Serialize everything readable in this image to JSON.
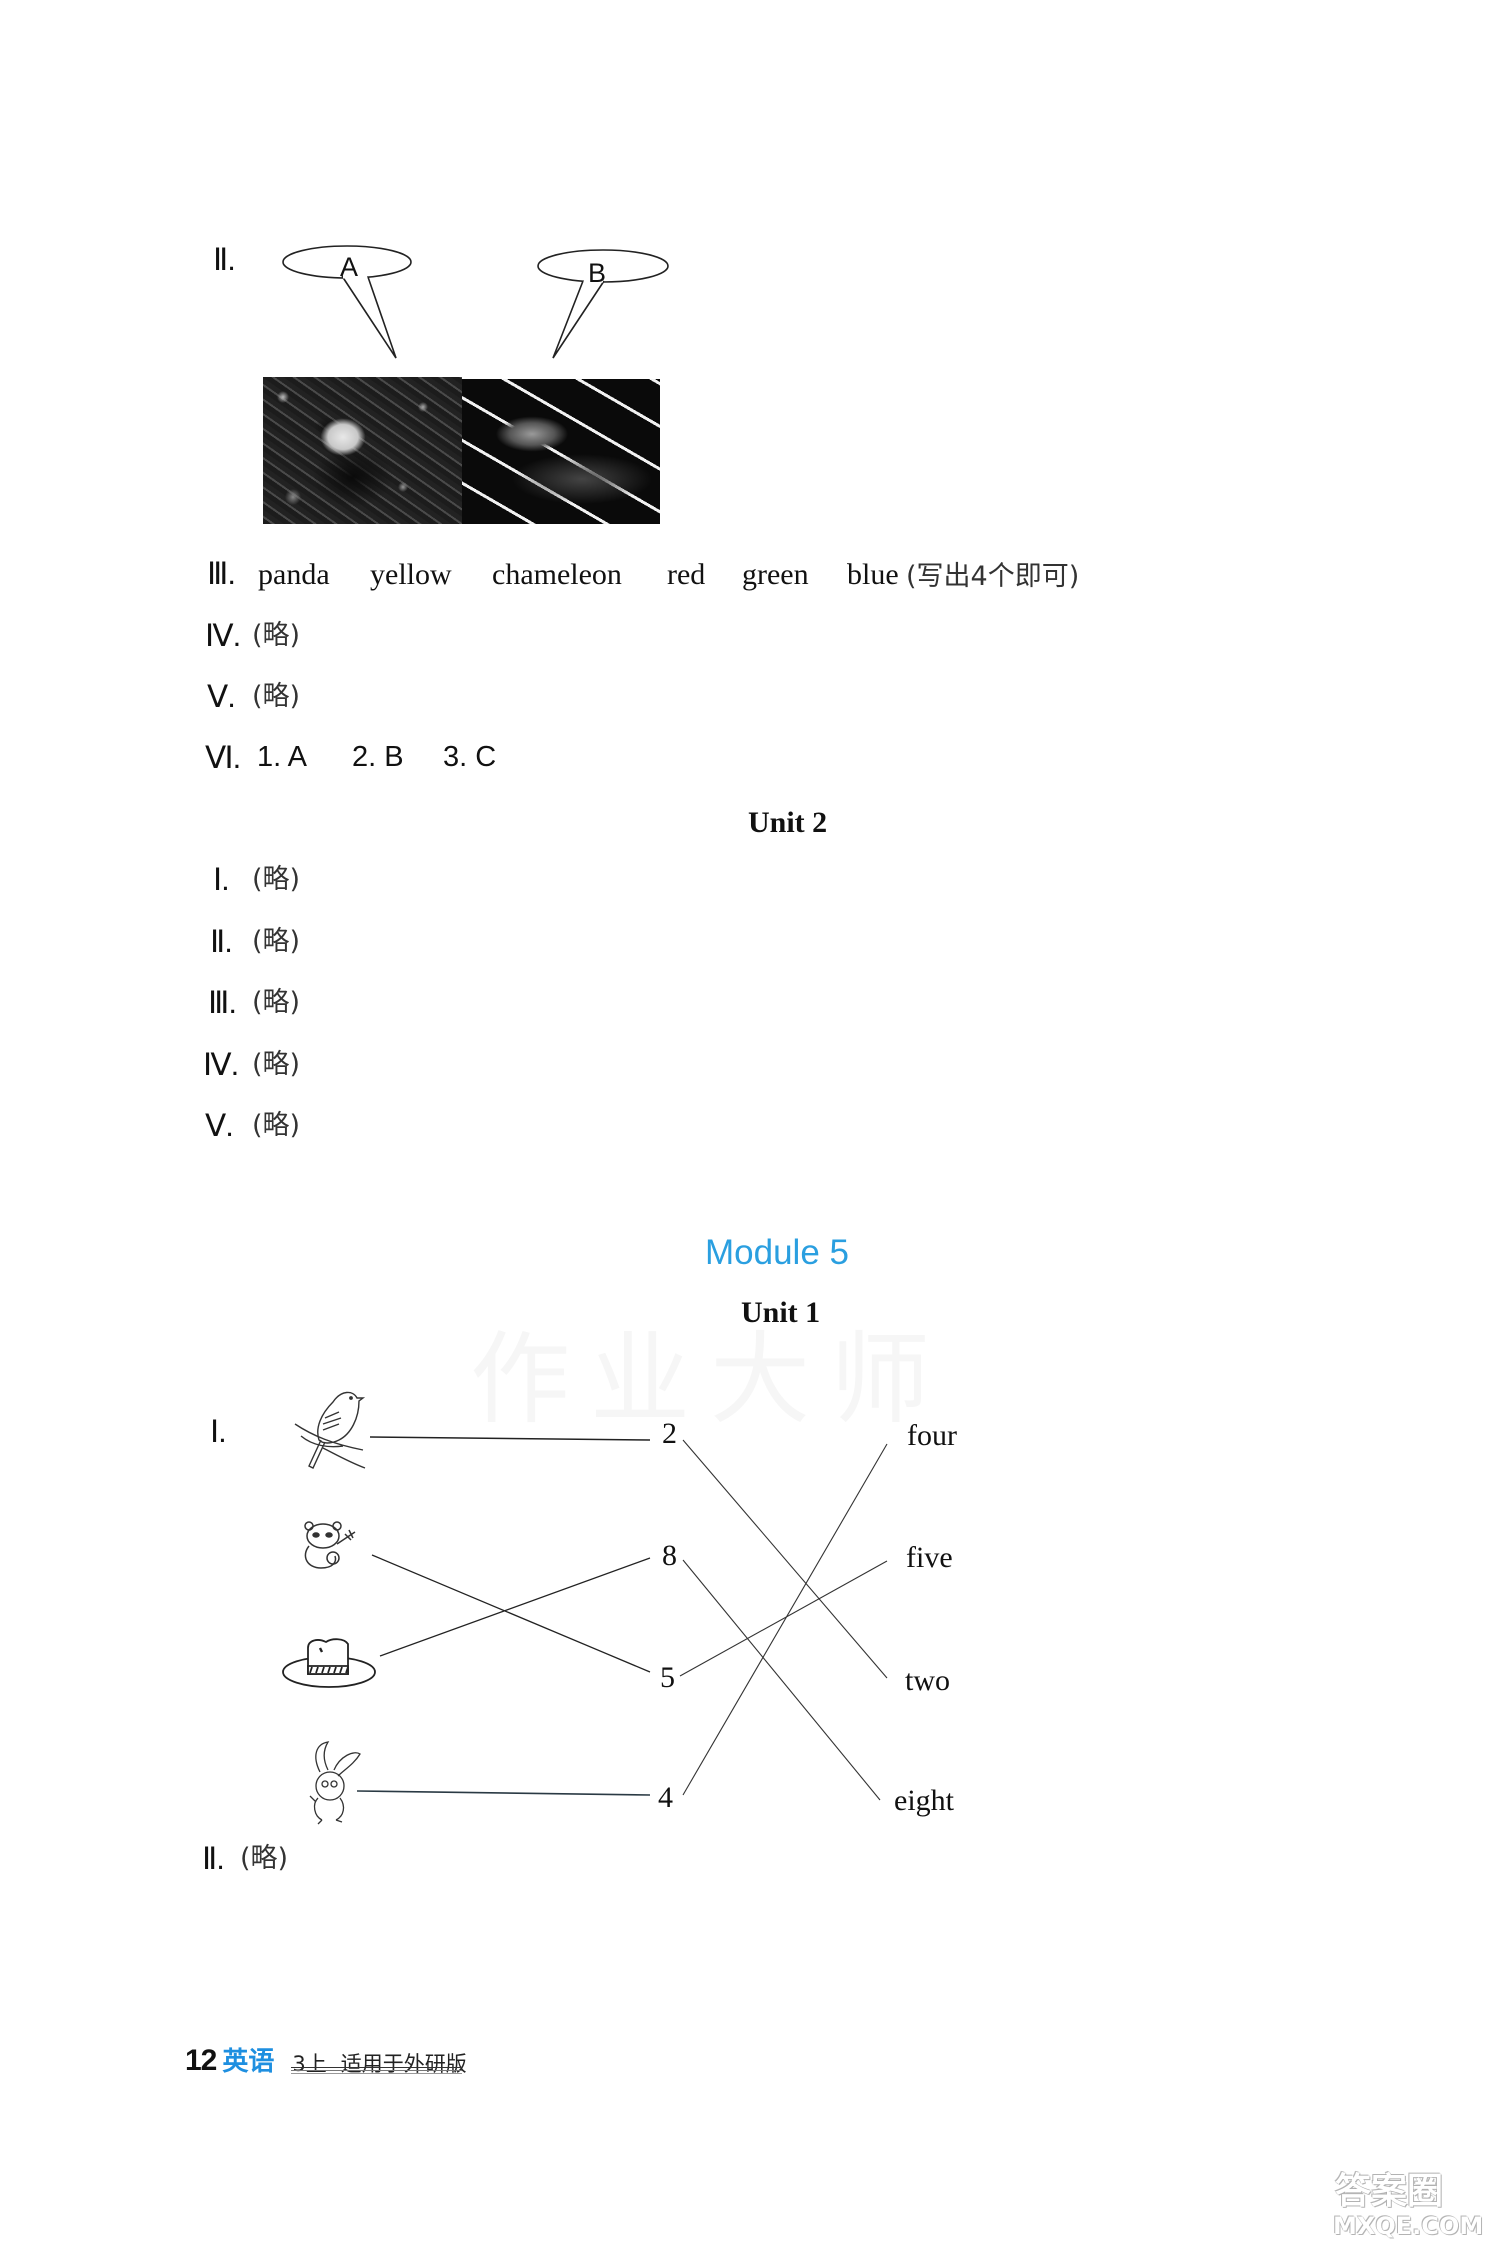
{
  "section_m4u1": {
    "q2": {
      "label": "Ⅱ.",
      "bubble_a": "A",
      "bubble_b": "B",
      "photo_left": "panda-photo",
      "photo_right": "chameleon-photo"
    },
    "q3": {
      "label": "Ⅲ.",
      "words": [
        "panda",
        "yellow",
        "chameleon",
        "red",
        "green",
        "blue"
      ],
      "note": "(写出4个即可)"
    },
    "q4": {
      "label": "Ⅳ.",
      "answer": "(略)"
    },
    "q5": {
      "label": "Ⅴ.",
      "answer": "(略)"
    },
    "q6": {
      "label": "Ⅵ.",
      "answers": [
        "1. A",
        "2. B",
        "3. C"
      ]
    }
  },
  "section_m4u2": {
    "title": "Unit 2",
    "items": [
      {
        "label": "Ⅰ.",
        "answer": "(略)"
      },
      {
        "label": "Ⅱ.",
        "answer": "(略)"
      },
      {
        "label": "Ⅲ.",
        "answer": "(略)"
      },
      {
        "label": "Ⅳ.",
        "answer": "(略)"
      },
      {
        "label": "Ⅴ.",
        "answer": "(略)"
      }
    ]
  },
  "section_m5": {
    "module_title": "Module 5",
    "unit_title": "Unit 1",
    "q1": {
      "label": "Ⅰ.",
      "pictures": [
        "bird",
        "panda",
        "hat",
        "rabbit"
      ],
      "numbers": [
        "2",
        "8",
        "5",
        "4"
      ],
      "words": [
        "four",
        "five",
        "two",
        "eight"
      ],
      "picture_to_number": [
        {
          "picture": "bird",
          "number": "2"
        },
        {
          "picture": "panda",
          "number": "5"
        },
        {
          "picture": "hat",
          "number": "8"
        },
        {
          "picture": "rabbit",
          "number": "4"
        }
      ],
      "number_to_word": [
        {
          "number": "2",
          "word": "two"
        },
        {
          "number": "8",
          "word": "eight"
        },
        {
          "number": "5",
          "word": "five"
        },
        {
          "number": "4",
          "word": "four"
        }
      ]
    },
    "q2": {
      "label": "Ⅱ.",
      "answer": "(略)"
    }
  },
  "footer": {
    "page_number": "12",
    "subject": "英语",
    "grade": "3上",
    "edition": "适用于外研版"
  },
  "watermarks": {
    "center": "作业大师",
    "site_cn": "答案圈",
    "site_url": "MXQE.COM"
  },
  "colors": {
    "module_title": "#2a9fe0",
    "subject": "#1e8fe0"
  }
}
